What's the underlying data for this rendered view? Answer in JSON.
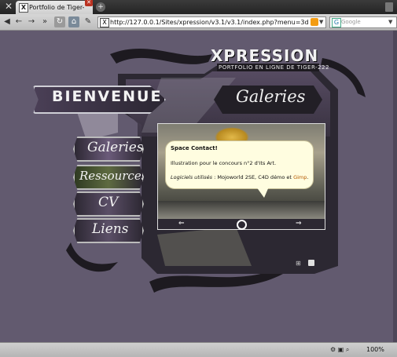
{
  "browser": {
    "tab_title": "Portfolio de Tiger-2...",
    "tab_favicon": "X",
    "url_favicon": "X",
    "url": "http://127.0.0.1/Sites/xpression/v3.1/v3.1/index.php?menu=3d",
    "search_placeholder": "Google",
    "zoom": "100%"
  },
  "site": {
    "logo": "XPRESSION",
    "subtitle": "PORTFOLIO EN LIGNE DE TIGER-222",
    "welcome": "BIENVENUE",
    "section_title": "Galeries",
    "menu": [
      {
        "label": "Galeries"
      },
      {
        "label": "Ressources"
      },
      {
        "label": "CV"
      },
      {
        "label": "Liens"
      }
    ]
  },
  "popup": {
    "title": "Space Contact!",
    "description": "Illustration pour le concours n°2 d'Its Art.",
    "software_label": "Logiciels utilisés",
    "software_sep": " : ",
    "software_list": "Mojoworld 2SE, C4D démo et ",
    "software_link": "Gimp",
    "software_end": "."
  },
  "icons": {
    "prev": "arrow-left-icon",
    "next": "arrow-right-icon",
    "zoom": "magnifier-icon",
    "sitemap": "sitemap-icon",
    "rss": "rss-icon"
  },
  "colors": {
    "page_bg": "#625a6f",
    "frame_dark": "#2c2832",
    "bubble_bg": "#fffde0",
    "link_orange": "#b55a00"
  }
}
